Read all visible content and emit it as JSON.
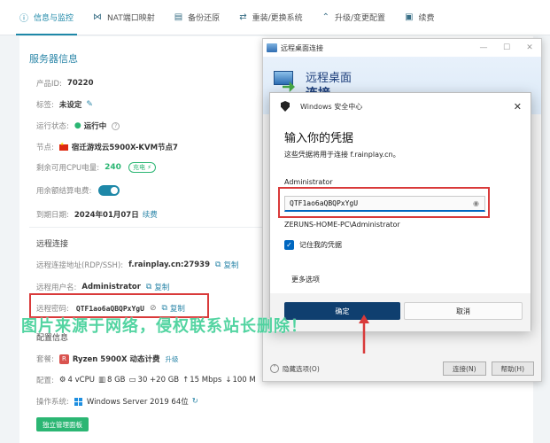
{
  "tabs": [
    {
      "label": "信息与监控",
      "icon": "info-icon",
      "glyph": "ⓘ",
      "active": true
    },
    {
      "label": "NAT端口映射",
      "icon": "network-icon",
      "glyph": "⋈",
      "active": false
    },
    {
      "label": "备份还原",
      "icon": "backup-icon",
      "glyph": "▤",
      "active": false
    },
    {
      "label": "重装/更换系统",
      "icon": "swap-icon",
      "glyph": "⇄",
      "active": false
    },
    {
      "label": "升级/变更配置",
      "icon": "upgrade-icon",
      "glyph": "⌃",
      "active": false
    },
    {
      "label": "续费",
      "icon": "renew-icon",
      "glyph": "▣",
      "active": false
    }
  ],
  "server": {
    "section_title": "服务器信息",
    "product_id_label": "产品ID:",
    "product_id": "70220",
    "tag_label": "标签:",
    "tag": "未设定",
    "run_status_label": "运行状态:",
    "run_status": "运行中",
    "node_label": "节点:",
    "node": "宿迁游戏云5900X-KVM节点7",
    "cpu_label": "剩余可用CPU电量:",
    "cpu_value": "240",
    "charge_label": "充电",
    "balance_label": "用余额结算电费:",
    "expire_label": "到期日期:",
    "expire_date": "2024年01月07日",
    "renew_link": "续费"
  },
  "remote": {
    "heading": "远程连接",
    "address_label": "远程连接地址(RDP/SSH):",
    "address": "f.rainplay.cn:27939",
    "user_label": "远程用户名:",
    "user": "Administrator",
    "password_label": "远程密码:",
    "password": "QTF1ao6aQBQPxYgU",
    "copy_label": "复制"
  },
  "config": {
    "heading": "配置信息",
    "package_label": "套餐:",
    "package": "Ryzen 5900X 动态计费",
    "upgrade_link": "升级",
    "config_label": "配置:",
    "vcpu": "4 vCPU",
    "ram": "8 GB",
    "disk": "30 +20 GB",
    "bandwidth": "15 Mbps",
    "traffic": "100 M",
    "os_label": "操作系统:",
    "os": "Windows Server 2019 64位",
    "panel_button": "独立管理面板"
  },
  "watermark": "图片来源于网络，侵权联系站长删除！",
  "rdp_window": {
    "title": "远程桌面连接",
    "header_line1": "远程桌面",
    "header_line2": "连接",
    "hide_options": "隐藏选项(O)",
    "connect": "连接(N)",
    "help": "帮助(H)"
  },
  "credential_dialog": {
    "window_title": "Windows 安全中心",
    "title": "输入你的凭据",
    "subtitle": "这些凭据将用于连接 f.rainplay.cn。",
    "username": "Administrator",
    "password_value": "QTF1ao6aQBQPxYgU",
    "account": "ZERUNS-HOME-PC\\Administrator",
    "remember": "记住我的凭据",
    "more_options": "更多选项",
    "ok": "确定",
    "cancel": "取消"
  },
  "colors": {
    "accent": "#1e88a8",
    "green": "#2bb673",
    "highlight_red": "#d93a3a",
    "dialog_primary": "#0f3f6f",
    "watermark": "#45d19a"
  }
}
